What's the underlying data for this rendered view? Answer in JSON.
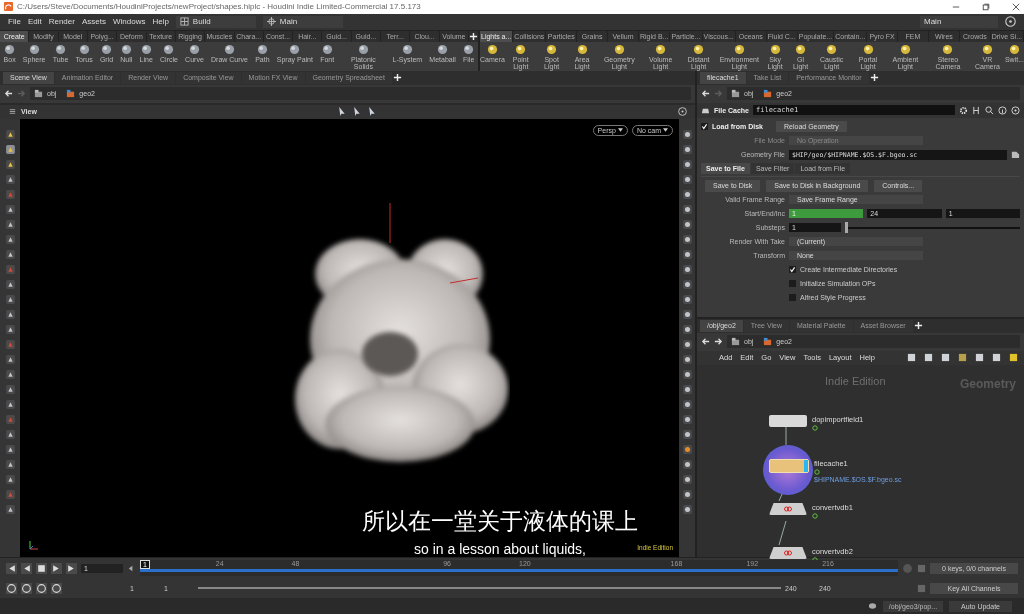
{
  "window": {
    "title": "C:/Users/Steve/Documents/HoudiniProjects/newProject/shapes.hiplc - Houdini Indie Limited-Commercial 17.5.173"
  },
  "menu": [
    "File",
    "Edit",
    "Render",
    "Assets",
    "Windows",
    "Help"
  ],
  "desktop": "Build",
  "context": "Main",
  "right_desktop": "Main",
  "shelf_left": {
    "tabs": [
      {
        "label": "Create",
        "selected": true
      },
      {
        "label": "Modify",
        "selected": false
      },
      {
        "label": "Model",
        "selected": false
      },
      {
        "label": "Polyg...",
        "selected": false
      },
      {
        "label": "Deform",
        "selected": false
      },
      {
        "label": "Texture",
        "selected": false
      },
      {
        "label": "Rigging",
        "selected": false
      },
      {
        "label": "Muscles",
        "selected": false
      },
      {
        "label": "Chara...",
        "selected": false
      },
      {
        "label": "Const...",
        "selected": false
      },
      {
        "label": "Hair...",
        "selected": false
      },
      {
        "label": "Guid...",
        "selected": false
      },
      {
        "label": "Guid...",
        "selected": false
      },
      {
        "label": "Terr...",
        "selected": false
      },
      {
        "label": "Clou...",
        "selected": false
      },
      {
        "label": "Volume",
        "selected": false
      }
    ],
    "tools": [
      "Box",
      "Sphere",
      "Tube",
      "Torus",
      "Grid",
      "Null",
      "Line",
      "Circle",
      "Curve",
      "Draw Curve",
      "Path",
      "Spray Paint",
      "Font",
      "Platonic Solids",
      "L-System",
      "Metaball",
      "File"
    ]
  },
  "shelf_right": {
    "tabs": [
      {
        "label": "Lights a...",
        "selected": true
      },
      {
        "label": "Collisions",
        "selected": false
      },
      {
        "label": "Particles",
        "selected": false
      },
      {
        "label": "Grains",
        "selected": false
      },
      {
        "label": "Vellum",
        "selected": false
      },
      {
        "label": "Rigid B...",
        "selected": false
      },
      {
        "label": "Particle...",
        "selected": false
      },
      {
        "label": "Viscous...",
        "selected": false
      },
      {
        "label": "Oceans",
        "selected": false
      },
      {
        "label": "Fluid C...",
        "selected": false
      },
      {
        "label": "Populate...",
        "selected": false
      },
      {
        "label": "Contain...",
        "selected": false
      },
      {
        "label": "Pyro FX",
        "selected": false
      },
      {
        "label": "FEM",
        "selected": false
      },
      {
        "label": "Wires",
        "selected": false
      },
      {
        "label": "Crowds",
        "selected": false
      },
      {
        "label": "Drive Si...",
        "selected": false
      }
    ],
    "tools": [
      "Camera",
      "Point Light",
      "Spot Light",
      "Area Light",
      "Geometry Light",
      "Volume Light",
      "Distant Light",
      "Environment Light",
      "Sky Light",
      "GI Light",
      "Caustic Light",
      "Portal Light",
      "Ambient Light",
      "Stereo Camera",
      "VR Camera",
      "Swit..."
    ]
  },
  "scene": {
    "tabs": [
      {
        "label": "Scene View",
        "selected": true
      },
      {
        "label": "Animation Editor",
        "selected": false
      },
      {
        "label": "Render View",
        "selected": false
      },
      {
        "label": "Composite View",
        "selected": false
      },
      {
        "label": "Motion FX View",
        "selected": false
      },
      {
        "label": "Geometry Spreadsheet",
        "selected": false
      }
    ],
    "path": [
      "obj",
      "geo2"
    ],
    "view_title": "View",
    "camera_menus": [
      "Persp",
      "No cam"
    ],
    "edition": "Indie Edition"
  },
  "params": {
    "tabs": [
      {
        "label": "filecache1",
        "selected": true
      },
      {
        "label": "Take List",
        "selected": false
      },
      {
        "label": "Performance Monitor",
        "selected": false
      }
    ],
    "path": [
      "obj",
      "geo2"
    ],
    "node_type": "File Cache",
    "node_name": "filecache1",
    "load_from_disk": {
      "label": "Load from Disk",
      "checked": true
    },
    "reload_button": "Reload Geometry",
    "top_rows": [
      {
        "kind": "menu",
        "label": "File Mode",
        "value": "No Operation",
        "disabled": true
      },
      {
        "kind": "file",
        "label": "Geometry File",
        "value": "$HIP/geo/$HIPNAME.$OS.$F.bgeo.sc",
        "disabled": false
      }
    ],
    "section_tabs": [
      {
        "label": "Save to File",
        "selected": true
      },
      {
        "label": "Save Filter",
        "selected": false
      },
      {
        "label": "Load from File",
        "selected": false
      }
    ],
    "buttons": [
      "Save to Disk",
      "Save to Disk in Background",
      "Controls..."
    ],
    "rows": [
      {
        "kind": "menu",
        "label": "Valid Frame Range",
        "value": "Save Frame Range",
        "disabled": false
      },
      {
        "kind": "triple",
        "label": "Start/End/Inc",
        "values": [
          {
            "value": "1",
            "highlighted": true
          },
          {
            "value": "24",
            "highlighted": false
          },
          {
            "value": "1",
            "highlighted": false
          }
        ],
        "disabled": false
      },
      {
        "kind": "slider",
        "label": "Substeps",
        "value": "1",
        "level": 0,
        "disabled": false
      },
      {
        "kind": "menu",
        "label": "Render With Take",
        "value": "(Current)",
        "disabled": false
      },
      {
        "kind": "menu",
        "label": "Transform",
        "value": "None",
        "disabled": false
      },
      {
        "kind": "checkbox",
        "label": "Create Intermediate Directories",
        "checked": true,
        "disabled": false
      },
      {
        "kind": "checkbox",
        "label": "Initialize Simulation OPs",
        "checked": false,
        "disabled": false
      },
      {
        "kind": "checkbox",
        "label": "Alfred Style Progress",
        "checked": false,
        "disabled": false
      }
    ]
  },
  "network": {
    "tabs": [
      {
        "label": "/obj/geo2",
        "selected": true
      },
      {
        "label": "Tree View",
        "selected": false
      },
      {
        "label": "Material Palette",
        "selected": false
      },
      {
        "label": "Asset Browser",
        "selected": false
      }
    ],
    "path": [
      "obj",
      "geo2"
    ],
    "menu": [
      "Add",
      "Edit",
      "Go",
      "View",
      "Tools",
      "Layout",
      "Help"
    ],
    "edition": "Indie Edition",
    "context": "Geometry",
    "nodes": [
      {
        "name": "dopimportfield1",
        "kind": "import",
        "selected": false
      },
      {
        "name": "filecache1",
        "kind": "cache",
        "selected": true,
        "comment": "$HIPNAME.$OS.$F.bgeo.sc"
      },
      {
        "name": "convertvdb1",
        "kind": "convert",
        "selected": false
      },
      {
        "name": "convertvdb2",
        "kind": "convert",
        "selected": false
      }
    ]
  },
  "timeline": {
    "frame": "1",
    "current": "1",
    "ticks": [
      "24",
      "48",
      "96",
      "120",
      "168",
      "192",
      "216"
    ],
    "range_start": [
      "1",
      "1"
    ],
    "range_end": [
      "240",
      "240"
    ],
    "keys": "0 keys, 0/0 channels",
    "key_menu": "Key All Channels"
  },
  "status": {
    "path": "/obj/geo3/pop...",
    "update": "Auto Update"
  },
  "subtitles": {
    "zh": "所以在一堂关于液体的课上",
    "en": "so in a lesson about liquids,"
  }
}
